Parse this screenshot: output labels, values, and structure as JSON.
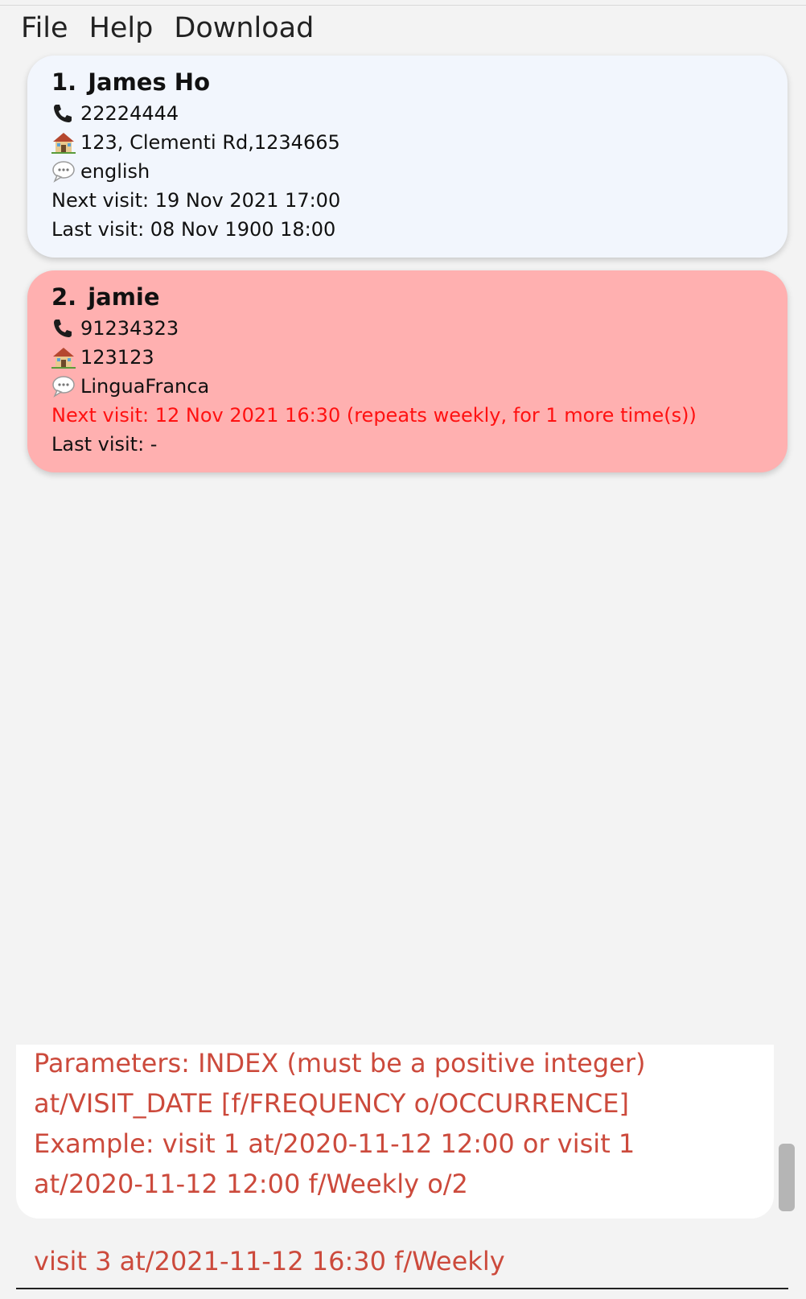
{
  "menu": {
    "file": "File",
    "help": "Help",
    "download": "Download"
  },
  "persons": [
    {
      "index": "1.",
      "name": "James Ho",
      "phone": "22224444",
      "address": "123, Clementi Rd,1234665",
      "language": "english",
      "next_visit": "Next visit: 19 Nov 2021 17:00",
      "last_visit": "Last visit: 08 Nov 1900 18:00"
    },
    {
      "index": "2.",
      "name": "jamie",
      "phone": "91234323",
      "address": "123123",
      "language": "LinguaFranca",
      "next_visit": "Next visit: 12 Nov 2021 16:30 (repeats weekly, for 1 more time(s))",
      "last_visit": "Last visit: -"
    }
  ],
  "result_display": {
    "text": "Parameters: INDEX (must be a positive integer) at/VISIT_DATE [f/FREQUENCY o/OCCURRENCE]\nExample: visit 1 at/2020-11-12 12:00 or visit 1 at/2020-11-12 12:00 f/Weekly o/2"
  },
  "command_box": {
    "value": "visit 3 at/2021-11-12 16:30 f/Weekly"
  },
  "colors": {
    "overdue_card": "#ffb0b0",
    "normal_card": "#f2f6fd",
    "warning_text": "#ff1111",
    "feedback_text": "#cc4a3c"
  },
  "icons": [
    "phone-icon",
    "house-icon",
    "chat-icon"
  ]
}
